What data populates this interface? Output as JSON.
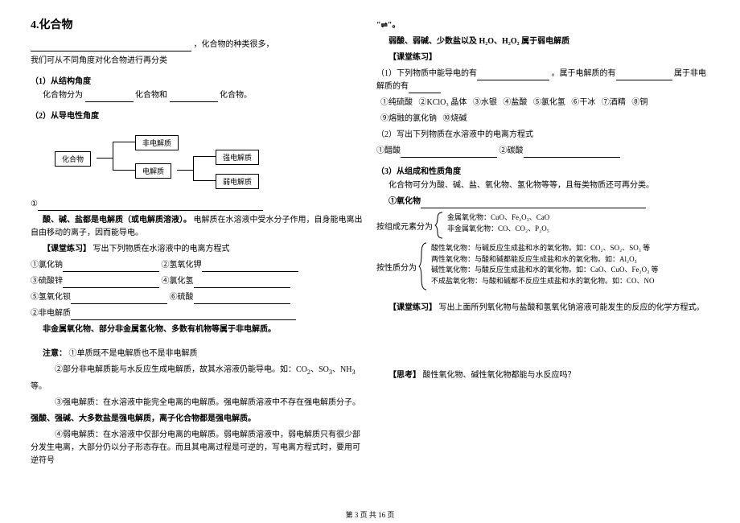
{
  "leftCol": {
    "title": "4.化合物",
    "intro1": "，化合物的种类很多，",
    "intro2": "我们可从不同角度对化合物进行再分类",
    "s1h": "（1）从结构角度",
    "s1t1": "化合物分为",
    "s1t2": "化合物和",
    "s1t3": "化合物。",
    "s2h": "（2）从导电性角度",
    "diag": {
      "compound": "化合物",
      "nonElec": "非电解质",
      "elec": "电解质",
      "strong": "强电解质",
      "weak": "弱电解质"
    },
    "circle1": "①",
    "elecDef": "酸、碱、盐都是电解质（或电解质溶液）。",
    "elecDef2": "电解质在水溶液中受水分子作用，自身能电离出自由移动的离子，因而能导电。",
    "ex1h": "【课堂练习】",
    "ex1t": "写出下列物质在水溶液中的电离方程式",
    "items": {
      "i1l": "①氯化钠",
      "i1r": "②氢氧化钾",
      "i2l": "③硫酸锌",
      "i2r": "④氯化氢",
      "i3l": "⑤氢氧化钡",
      "i3r": "⑥硫酸",
      "i4l": "②非电解质"
    },
    "nonElecNote": "非金属氧化物、部分非金属氢化物、多数有机物等属于非电解质。",
    "noteh": "注意：",
    "n1": "①单质既不是电解质也不是非电解质",
    "n2a": "②部分非电解质能与水反应生成电解质，故其水溶液仍能导电。如：CO",
    "n2b": "、SO",
    "n2c": "、NH",
    "n2d": "等。",
    "n3a": "③强电解质：在水溶液中能完全电离的电解质。强电解质溶液中不存在强电解质分子。",
    "n3b": "强酸、强碱、大多数盐是强电解质，离子化合物都是强电解质。",
    "n4": "④弱电解质：在水溶液中仅部分电离的电解质。弱电解质溶液中，弱电解质只有很少部分发生电离，大部分仍以分子形态存在。而且其电离过程是可逆的，写电离方程式时，要用可逆符号"
  },
  "rightCol": {
    "arrow": "\"⇌\"。",
    "weakNote": "弱酸、弱碱、少数盐以及 H₂O、H₂O₂ 属于弱电解质",
    "ex2h": "【课堂练习】",
    "ex2q1a": "（1）下列物质中能导电的有",
    "ex2q1b": "。属于电解质的有",
    "ex2q1c": "属于非电解质的有",
    "opts": {
      "o1": "①纯硫酸",
      "o2": "②KClO₃ 晶体",
      "o3": "③水银",
      "o4": "④盐酸",
      "o5": "⑤氯化氢",
      "o6": "⑥干冰",
      "o7": "⑦酒精",
      "o8": "⑧铜",
      "o9": "⑨熔融的氯化钠",
      "o10": "⑩烧碱"
    },
    "ex2q2": "（2）写出下列物质在水溶液中的电离方程式",
    "q2a": "①醋酸",
    "q2b": "②碳酸",
    "s3h": "（3）从组成和性质角度",
    "s3intro": "化合物可分为酸、碱、盐、氧化物、氢化物等等，且每类物质还可再分类。",
    "oxideH": "①氧化物",
    "compLabel": "按组成元素分为",
    "comp1": "金属氧化物：CuO、Fe₂O₃、CaO",
    "comp2": "非金属氧化物：CO、CO₂、P₂O₅",
    "propLabel": "按性质分为",
    "prop1": "酸性氧化物：与碱反应生成盐和水的氧化物。如：CO₂、SO₂、SO₃ 等",
    "prop2": "两性氧化物：与酸和碱都能反应生成盐和水的氧化物。如：Al₂O₃",
    "prop3": "碱性氧化物：与酸反应生成盐和水的氧化物。如：CaO、CuO、Fe₂O₃ 等",
    "prop4": "不成盐氧化物：与酸和碱都不反应生成盐和水的氧化物。如：CO、NO",
    "ex3h": "【课堂练习】",
    "ex3t": "写出上面所列氧化物与盐酸和氢氧化钠溶液可能发生的反应的化学方程式。",
    "thinkH": "【思考】",
    "thinkT": "酸性氧化物、碱性氧化物都能与水反应吗？"
  },
  "footer": "第 3 页 共 16 页"
}
